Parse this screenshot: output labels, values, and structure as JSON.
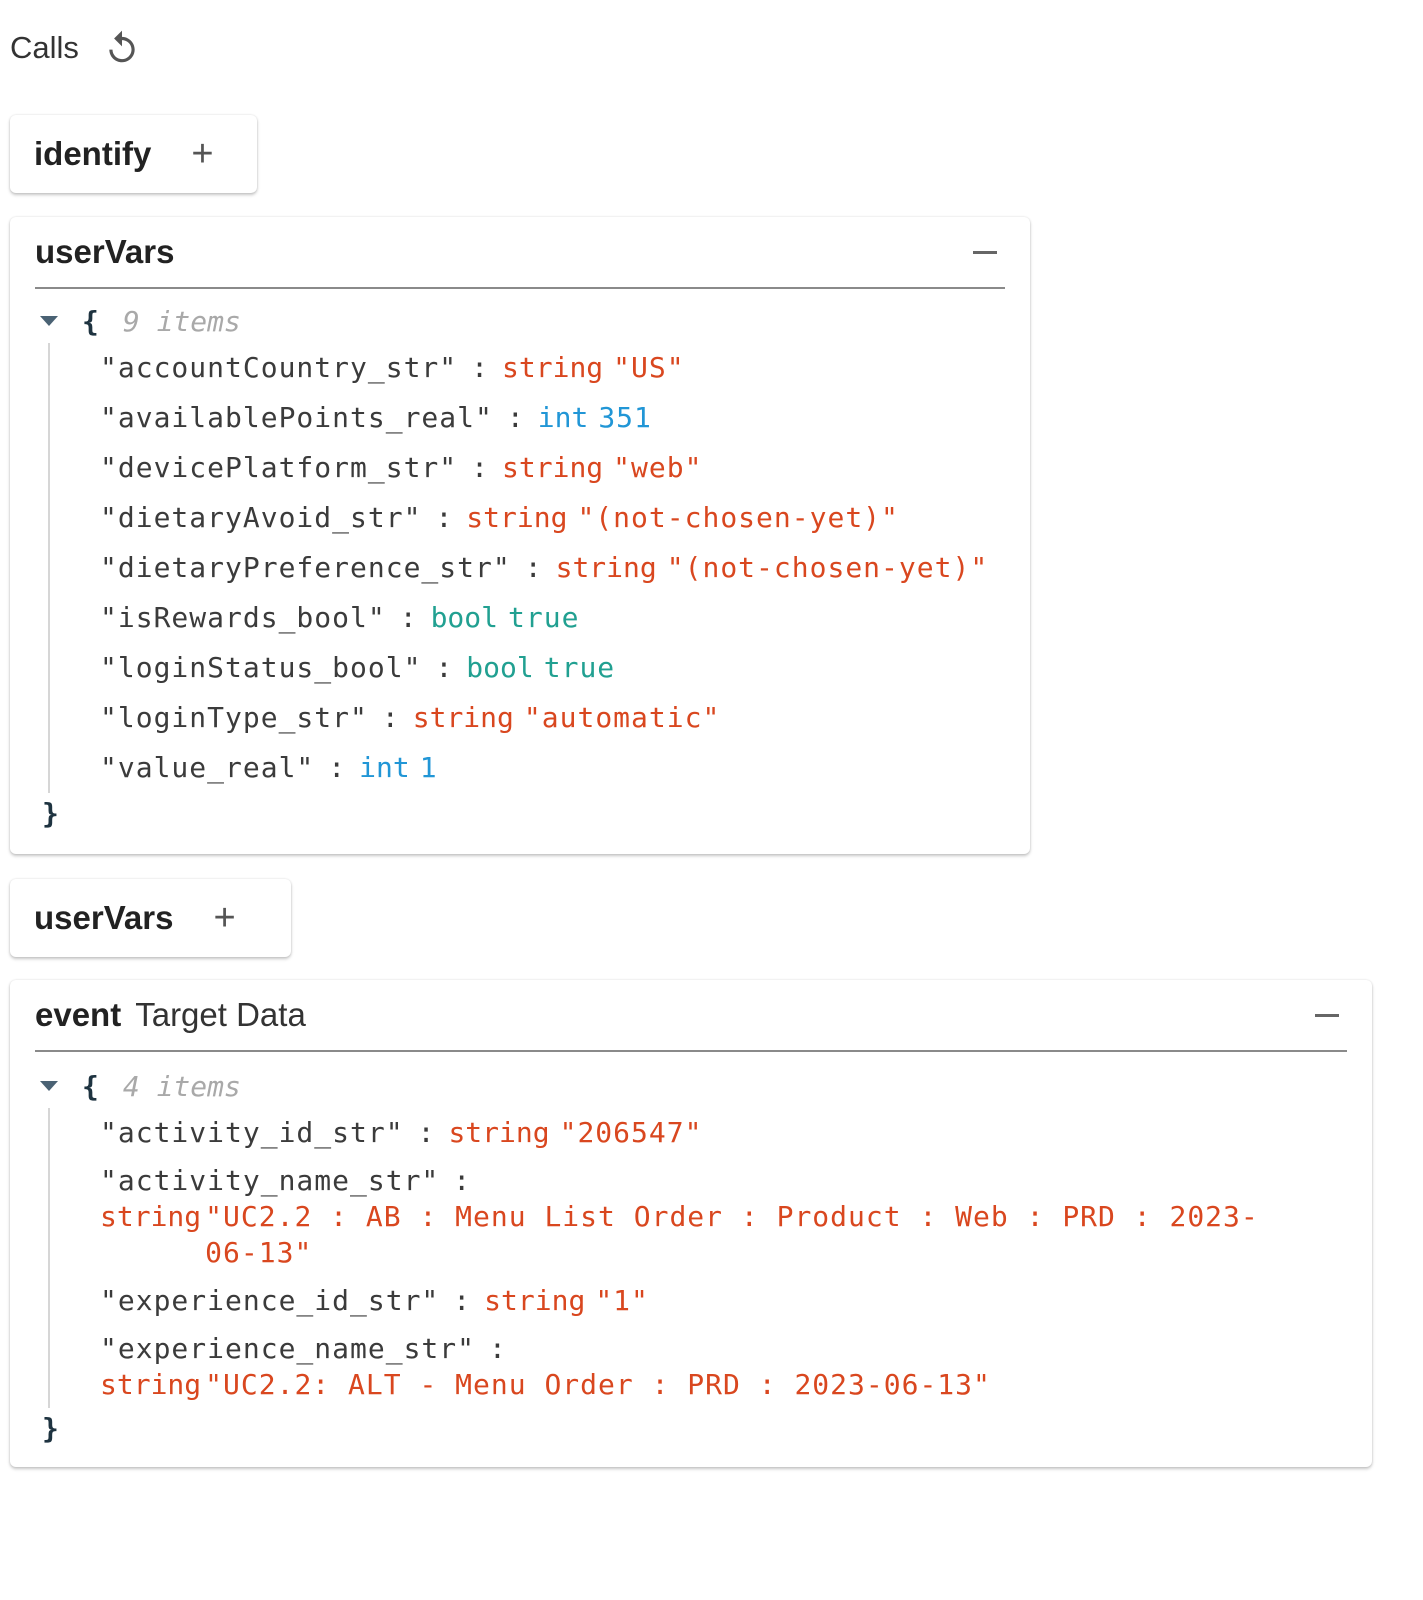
{
  "header": {
    "title": "Calls"
  },
  "identify_chip": {
    "label": "identify",
    "plus": "+"
  },
  "uservars_panel": {
    "title": "userVars",
    "json": {
      "open": "{",
      "count": "9 items",
      "close": "}",
      "rows": [
        {
          "key": "\"accountCountry_str\"",
          "colon": ":",
          "type": "string",
          "value": "\"US\""
        },
        {
          "key": "\"availablePoints_real\"",
          "colon": ":",
          "type": "int",
          "value": "351"
        },
        {
          "key": "\"devicePlatform_str\"",
          "colon": ":",
          "type": "string",
          "value": "\"web\""
        },
        {
          "key": "\"dietaryAvoid_str\"",
          "colon": ":",
          "type": "string",
          "value": "\"(not-chosen-yet)\""
        },
        {
          "key": "\"dietaryPreference_str\"",
          "colon": ":",
          "type": "string",
          "value": "\"(not-chosen-yet)\""
        },
        {
          "key": "\"isRewards_bool\"",
          "colon": ":",
          "type": "bool",
          "value": "true"
        },
        {
          "key": "\"loginStatus_bool\"",
          "colon": ":",
          "type": "bool",
          "value": "true"
        },
        {
          "key": "\"loginType_str\"",
          "colon": ":",
          "type": "string",
          "value": "\"automatic\""
        },
        {
          "key": "\"value_real\"",
          "colon": ":",
          "type": "int",
          "value": "1"
        }
      ]
    }
  },
  "uservars_chip": {
    "label": "userVars",
    "plus": "+"
  },
  "event_panel": {
    "title": "event",
    "subtitle": "Target Data",
    "json": {
      "open": "{",
      "count": "4 items",
      "close": "}",
      "rows": [
        {
          "key": "\"activity_id_str\"",
          "colon": ":",
          "type": "string",
          "value": "\"206547\""
        },
        {
          "key": "\"activity_name_str\"",
          "colon": ":",
          "type": "string",
          "value": "\"UC2.2 : AB : Menu List Order : Product : Web : PRD : 2023-06-13\""
        },
        {
          "key": "\"experience_id_str\"",
          "colon": ":",
          "type": "string",
          "value": "\"1\""
        },
        {
          "key": "\"experience_name_str\"",
          "colon": ":",
          "type": "string",
          "value": "\"UC2.2: ALT - Menu Order : PRD : 2023-06-13\""
        }
      ]
    }
  },
  "colors": {
    "string": "#d9471f",
    "int": "#2196d6",
    "bool": "#21a091",
    "key": "#3b3b3b"
  }
}
